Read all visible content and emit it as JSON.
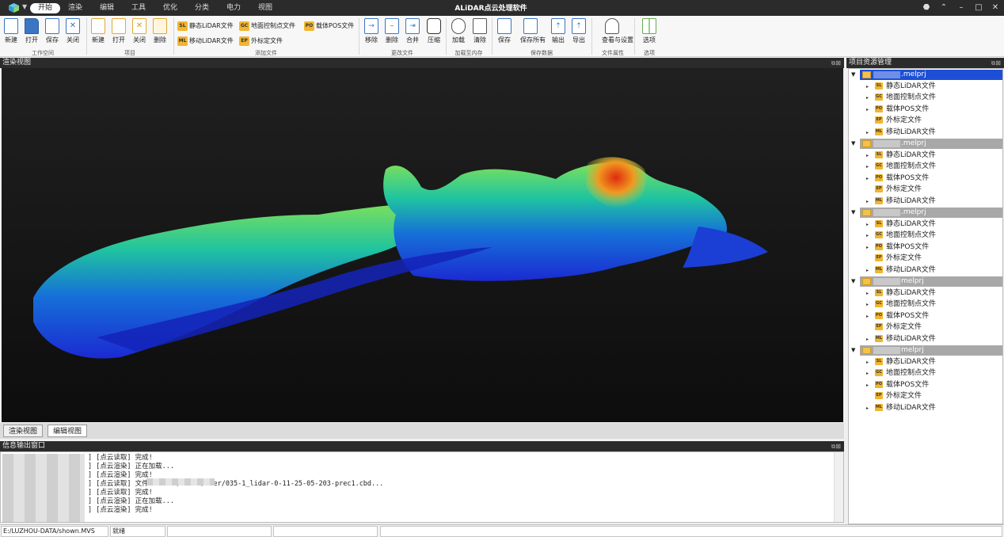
{
  "app": {
    "title": "ALiDAR点云处理软件",
    "menu_tabs": [
      "开始",
      "渲染",
      "编辑",
      "工具",
      "优化",
      "分类",
      "电力",
      "视图"
    ],
    "active_tab": "开始"
  },
  "ribbon": {
    "workspace": {
      "new": "新建",
      "open": "打开",
      "save": "保存",
      "close": "关闭",
      "group": "工作空间"
    },
    "project": {
      "new": "新建",
      "open": "打开",
      "close": "关闭",
      "delete": "删除",
      "group": "项目"
    },
    "add_files": {
      "static_lidar": "静态LiDAR文件",
      "mobile_lidar": "移动LiDAR文件",
      "gcp": "地面控制点文件",
      "ext_calib": "外标定文件",
      "pos": "载体POS文件",
      "group": "添加文件"
    },
    "change_files": {
      "move": "移除",
      "delete": "删除",
      "merge": "合并",
      "compress": "压缩",
      "group": "更改文件"
    },
    "load_cache": {
      "load": "加载",
      "clear": "清除",
      "group": "加载至内存"
    },
    "save_data": {
      "save": "保存",
      "save_all": "保存所有",
      "export": "输出",
      "export2": "导出",
      "group": "保存数据"
    },
    "file_props": {
      "view_settings": "查看与设置",
      "group": "文件属性"
    },
    "options": {
      "options": "选项",
      "group": "选项"
    },
    "icons": {
      "new": "new-doc-icon",
      "open": "open-folder-icon",
      "save": "save-icon",
      "close": "close-icon",
      "delete": "trash-icon"
    }
  },
  "render_panel": {
    "title": "渲染视图"
  },
  "view_tabs": [
    "渲染视图",
    "编辑视图"
  ],
  "log_panel": {
    "title": "信息输出窗口",
    "lines": [
      "] [点云读取] 完成!",
      "] [点云渲染] 正在加载...",
      "] [点云渲染] 完成!",
      "] [点云读取] 文件                    040501/LiDAR/User/035-1_lidar-0-11-25-05-203-prec1.cbd...",
      "] [点云读取] 完成!",
      "] [点云渲染] 正在加载...",
      "] [点云渲染] 完成!"
    ]
  },
  "tree_panel": {
    "title": "项目资源管理",
    "projects": [
      {
        "name": ".melprj",
        "items": [
          "静态LiDAR文件",
          "地面控制点文件",
          "载体POS文件",
          "外标定文件",
          "移动LiDAR文件"
        ],
        "tags": [
          "SL",
          "GC",
          "PO",
          "EP",
          "ML"
        ],
        "selected": true
      },
      {
        "name": ".melprj",
        "items": [
          "静态LiDAR文件",
          "地面控制点文件",
          "载体POS文件",
          "外标定文件",
          "移动LiDAR文件"
        ],
        "tags": [
          "SL",
          "GC",
          "PO",
          "EP",
          "ML"
        ],
        "selected": false
      },
      {
        "name": ".melprj",
        "items": [
          "静态LiDAR文件",
          "地面控制点文件",
          "载体POS文件",
          "外标定文件",
          "移动LiDAR文件"
        ],
        "tags": [
          "SL",
          "GC",
          "PO",
          "EP",
          "ML"
        ],
        "selected": false
      },
      {
        "name": "melprj",
        "items": [
          "静态LiDAR文件",
          "地面控制点文件",
          "载体POS文件",
          "外标定文件",
          "移动LiDAR文件"
        ],
        "tags": [
          "SL",
          "GC",
          "PO",
          "EP",
          "ML"
        ],
        "selected": false
      },
      {
        "name": "melprj",
        "items": [
          "静态LiDAR文件",
          "地面控制点文件",
          "载体POS文件",
          "外标定文件",
          "移动LiDAR文件"
        ],
        "tags": [
          "SL",
          "GC",
          "PO",
          "EP",
          "ML"
        ],
        "selected": false
      }
    ]
  },
  "status_bar": {
    "path": "E:/LUZHOU-DATA/shown.MVS",
    "state": "就绪"
  },
  "colors": {
    "dark": "#2b2b2b",
    "accent": "#1d4fd6",
    "tag": "#f2b530"
  }
}
